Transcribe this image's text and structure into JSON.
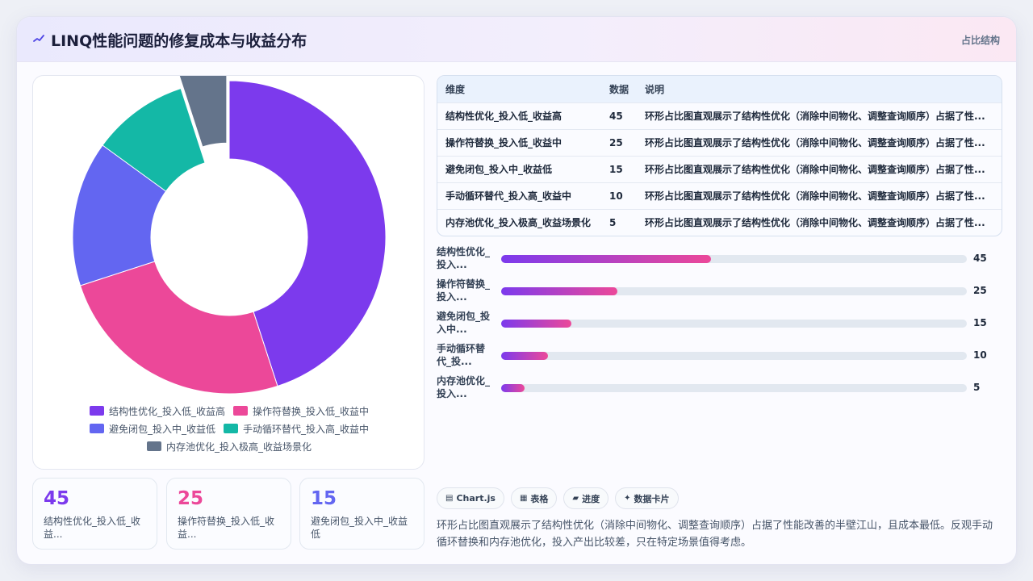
{
  "header": {
    "title": "LINQ性能问题的修复成本与收益分布",
    "tag": "占比结构"
  },
  "colors": [
    "#7c3aed",
    "#ec4899",
    "#6366f1",
    "#14b8a6",
    "#64748b"
  ],
  "chart_data": {
    "type": "pie",
    "variant": "doughnut",
    "categories": [
      "结构性优化_投入低_收益高",
      "操作符替换_投入低_收益中",
      "避免闭包_投入中_收益低",
      "手动循环替代_投入高_收益中",
      "内存池优化_投入极高_收益场景化"
    ],
    "values": [
      45,
      25,
      15,
      10,
      5
    ],
    "legend_position": "bottom"
  },
  "table": {
    "headers": [
      "维度",
      "数据",
      "说明"
    ],
    "rows": [
      {
        "dim": "结构性优化_投入低_收益高",
        "value": "45",
        "desc": "环形占比图直观展示了结构性优化（消除中间物化、调整查询顺序）占据了性..."
      },
      {
        "dim": "操作符替换_投入低_收益中",
        "value": "25",
        "desc": "环形占比图直观展示了结构性优化（消除中间物化、调整查询顺序）占据了性..."
      },
      {
        "dim": "避免闭包_投入中_收益低",
        "value": "15",
        "desc": "环形占比图直观展示了结构性优化（消除中间物化、调整查询顺序）占据了性..."
      },
      {
        "dim": "手动循环替代_投入高_收益中",
        "value": "10",
        "desc": "环形占比图直观展示了结构性优化（消除中间物化、调整查询顺序）占据了性..."
      },
      {
        "dim": "内存池优化_投入极高_收益场景化",
        "value": "5",
        "desc": "环形占比图直观展示了结构性优化（消除中间物化、调整查询顺序）占据了性..."
      }
    ]
  },
  "bars": {
    "max": 100,
    "items": [
      {
        "label": "结构性优化_投入...",
        "value": 45
      },
      {
        "label": "操作符替换_投入...",
        "value": 25
      },
      {
        "label": "避免闭包_投入中...",
        "value": 15
      },
      {
        "label": "手动循环替代_投...",
        "value": 10
      },
      {
        "label": "内存池优化_投入...",
        "value": 5
      }
    ]
  },
  "kpis": [
    {
      "value": "45",
      "label": "结构性优化_投入低_收益...",
      "color": "#7c3aed"
    },
    {
      "value": "25",
      "label": "操作符替换_投入低_收益...",
      "color": "#ec4899"
    },
    {
      "value": "15",
      "label": "避免闭包_投入中_收益低",
      "color": "#6366f1"
    }
  ],
  "chips": [
    {
      "icon": "chart-icon",
      "glyph": "▤",
      "label": "Chart.js"
    },
    {
      "icon": "table-icon",
      "glyph": "▦",
      "label": "表格"
    },
    {
      "icon": "progress-icon",
      "glyph": "▰",
      "label": "进度"
    },
    {
      "icon": "sparkle-icon",
      "glyph": "✦",
      "label": "数据卡片"
    }
  ],
  "summary": "环形占比图直观展示了结构性优化（消除中间物化、调整查询顺序）占据了性能改善的半壁江山，且成本最低。反观手动循环替换和内存池优化，投入产出比较差，只在特定场景值得考虑。"
}
